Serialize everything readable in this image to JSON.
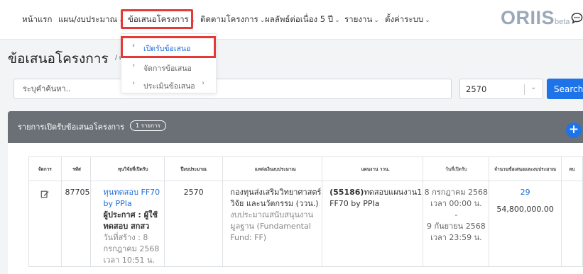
{
  "nav": {
    "items": [
      {
        "label": "หน้าแรก",
        "has_dropdown": false
      },
      {
        "label": "แผน/งบประมาณ",
        "has_dropdown": true
      },
      {
        "label": "ข้อเสนอโครงการ",
        "has_dropdown": true
      },
      {
        "label": "ติดตามโครงการ",
        "has_dropdown": true
      },
      {
        "label": "ผลลัพธ์ต่อเนื่อง 5 ปี",
        "has_dropdown": true
      },
      {
        "label": "รายงาน",
        "has_dropdown": true
      },
      {
        "label": "ตั้งค่าระบบ",
        "has_dropdown": true
      }
    ],
    "logo": "ORIIS",
    "logo_suffix": "beta",
    "chat_icon": "chat-icon"
  },
  "page": {
    "title": "ข้อเสนอโครงการ",
    "breadcrumb": "/ เปิดรับ"
  },
  "dropdown": {
    "items": [
      {
        "label": "เปิดรับข้อเสนอ",
        "active": true,
        "has_sub": false
      },
      {
        "label": "จัดการข้อเสนอ",
        "active": false,
        "has_sub": false
      },
      {
        "label": "ประเมินข้อเสนอ",
        "active": false,
        "has_sub": true
      }
    ]
  },
  "search": {
    "placeholder": "ระบุคำค้นหา..",
    "value": "",
    "year": "2570",
    "button_label": "Search"
  },
  "card": {
    "title": "รายการเปิดรับข้อเสนอโครงการ",
    "count_badge": "1 รายการ",
    "add_icon": "plus-icon"
  },
  "table": {
    "headers": [
      "จัดการ",
      "รหัส",
      "ทุนวิจัยที่เปิดรับ",
      "ปีงบประมาณ",
      "แหล่งเงินงบประมาณ",
      "แผนงาน ววน.",
      "วันที่เปิดรับ",
      "จำนวนข้อเสนอและงบประมาณ",
      "ลบ"
    ],
    "rows": [
      {
        "code": "87705",
        "fund_name": "ทุนทดสอบ FF70 by PPIa",
        "announcer": "ผู้ประกาศ : ผู้ใช้ทดสอบ สกสว",
        "created": "วันที่สร้าง : 8 กรกฎาคม 2568 เวลา 10:51 น.",
        "year": "2570",
        "source_main": "กองทุนส่งเสริมวิทยาศาสตร์ วิจัย และนวัตกรรม (ววน.)",
        "source_sub": "งบประมาณสนับสนุนงานมูลฐาน (Fundamental Fund: FF)",
        "plan_code": "(55186)",
        "plan_name": "ทดสอบแผนงาน1 FF70 by PPIa",
        "date_start": "8 กรกฎาคม 2568 เวลา 00:00 น.",
        "date_sep": "-",
        "date_end": "9 กันยายน 2568 เวลา 23:59 น.",
        "proposal_count": "29",
        "budget": "54,800,000.00"
      }
    ]
  }
}
